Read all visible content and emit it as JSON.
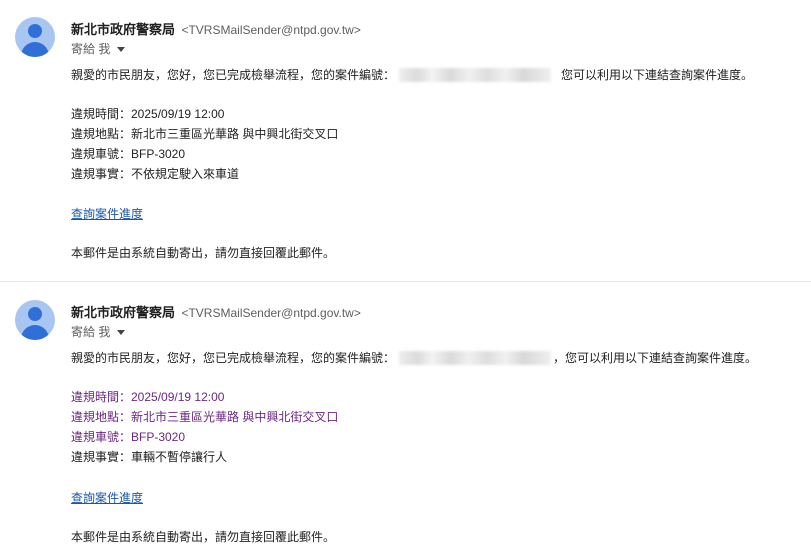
{
  "emails": [
    {
      "sender_name": "新北市政府警察局",
      "sender_email": "<TVRSMailSender@ntpd.gov.tw>",
      "recipient": "寄給 我",
      "greeting_before": "親愛的市民朋友，您好，您已完成檢舉流程，您的案件編號：",
      "greeting_after": "您可以利用以下連結查詢案件進度。",
      "details": [
        "違規時間：2025/09/19 12:00",
        "違規地點：新北市三重區光華路 與中興北街交叉口",
        "違規車號：BFP-3020",
        "違規事實：不依規定駛入來車道"
      ],
      "link_text": "查詢案件進度",
      "footer": "本郵件是由系統自動寄出，請勿直接回覆此郵件。"
    },
    {
      "sender_name": "新北市政府警察局",
      "sender_email": "<TVRSMailSender@ntpd.gov.tw>",
      "recipient": "寄給 我",
      "greeting_before": "親愛的市民朋友，您好，您已完成檢舉流程，您的案件編號：",
      "greeting_after": "，您可以利用以下連結查詢案件進度。",
      "details": [
        "違規時間：2025/09/19 12:00",
        "違規地點：新北市三重區光華路 與中興北街交叉口",
        "違規車號：BFP-3020",
        "違規事實：車輛不暫停讓行人"
      ],
      "link_text": "查詢案件進度",
      "footer": "本郵件是由系統自動寄出，請勿直接回覆此郵件。"
    }
  ],
  "colors": {
    "avatar_bg": "#a9c6f2",
    "avatar_fg": "#2f6fd6",
    "link": "#1a57a8",
    "visited_purple": "#6b2780"
  }
}
